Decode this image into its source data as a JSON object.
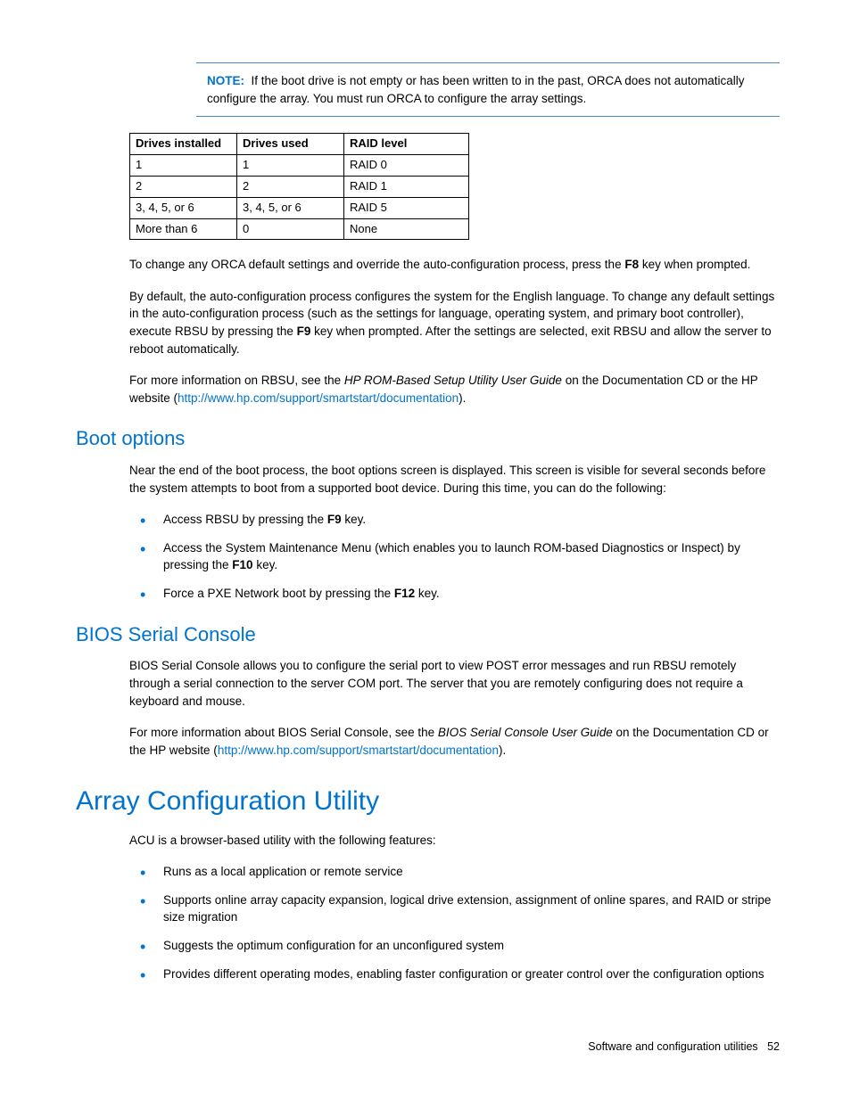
{
  "note": {
    "label": "NOTE:",
    "text": "If the boot drive is not empty or has been written to in the past, ORCA does not automatically configure the array. You must run ORCA to configure the array settings."
  },
  "table": {
    "headers": [
      "Drives installed",
      "Drives used",
      "RAID level"
    ],
    "rows": [
      [
        "1",
        "1",
        "RAID 0"
      ],
      [
        "2",
        "2",
        "RAID 1"
      ],
      [
        "3, 4, 5, or 6",
        "3, 4, 5, or 6",
        "RAID 5"
      ],
      [
        "More than 6",
        "0",
        "None"
      ]
    ]
  },
  "para_orca_pre": "To change any ORCA default settings and override the auto-configuration process, press the ",
  "para_orca_key": "F8",
  "para_orca_post": " key when prompted.",
  "para_auto_pre": "By default, the auto-configuration process configures the system for the English language. To change any default settings in the auto-configuration process (such as the settings for language, operating system, and primary boot controller), execute RBSU by pressing the ",
  "para_auto_key": "F9",
  "para_auto_post": " key when prompted. After the settings are selected, exit RBSU and allow the server to reboot automatically.",
  "para_rbsu_pre": "For more information on RBSU, see the ",
  "para_rbsu_title": "HP ROM-Based Setup Utility User Guide",
  "para_rbsu_mid": " on the Documentation CD or the HP website (",
  "para_rbsu_link": "http://www.hp.com/support/smartstart/documentation",
  "para_rbsu_post": ").",
  "boot_heading": "Boot options",
  "boot_intro": "Near the end of the boot process, the boot options screen is displayed. This screen is visible for several seconds before the system attempts to boot from a supported boot device. During this time, you can do the following:",
  "boot_items": [
    {
      "pre": "Access RBSU by pressing the ",
      "key": "F9",
      "post": " key."
    },
    {
      "pre": "Access the System Maintenance Menu (which enables you to launch ROM-based Diagnostics or Inspect) by pressing the ",
      "key": "F10",
      "post": " key."
    },
    {
      "pre": "Force a PXE Network boot by pressing the ",
      "key": "F12",
      "post": " key."
    }
  ],
  "bios_heading": "BIOS Serial Console",
  "bios_p1": "BIOS Serial Console allows you to configure the serial port to view POST error messages and run RBSU remotely through a serial connection to the server COM port. The server that you are remotely configuring does not require a keyboard and mouse.",
  "bios_p2_pre": "For more information about BIOS Serial Console, see the ",
  "bios_p2_title": "BIOS Serial Console User Guide",
  "bios_p2_mid": " on the Documentation CD or the HP website (",
  "bios_p2_link": "http://www.hp.com/support/smartstart/documentation",
  "bios_p2_post": ").",
  "acu_heading": "Array Configuration Utility",
  "acu_intro": "ACU is a browser-based utility with the following features:",
  "acu_items": [
    "Runs as a local application or remote service",
    "Supports online array capacity expansion, logical drive extension, assignment of online spares, and RAID or stripe size migration",
    "Suggests the optimum configuration for an unconfigured system",
    "Provides different operating modes, enabling faster configuration or greater control over the configuration options"
  ],
  "footer_section": "Software and configuration utilities",
  "footer_page": "52"
}
